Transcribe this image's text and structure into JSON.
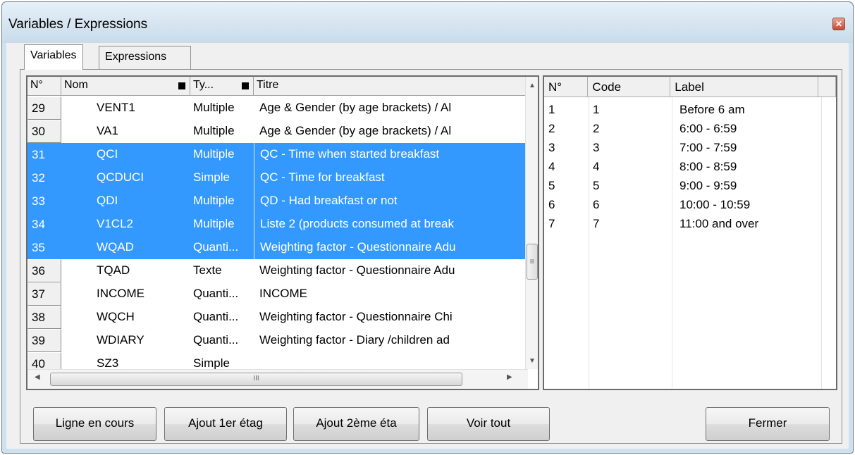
{
  "window": {
    "title": "Variables / Expressions",
    "close_glyph": "✕"
  },
  "tabs": [
    {
      "label": "Variables",
      "active": true
    },
    {
      "label": "Expressions",
      "active": false
    }
  ],
  "variables_grid": {
    "headers": {
      "no": "N°",
      "nom": "Nom",
      "type": "Ty...",
      "titre": "Titre"
    },
    "rows": [
      {
        "no": "29",
        "nom": "VENT1",
        "type": "Multiple",
        "titre": "Age & Gender (by age brackets) / Al",
        "selected": false
      },
      {
        "no": "30",
        "nom": "VA1",
        "type": "Multiple",
        "titre": "Age & Gender (by age brackets) / Al",
        "selected": false
      },
      {
        "no": "31",
        "nom": "QCI",
        "type": "Multiple",
        "titre": "QC - Time when started breakfast",
        "selected": true
      },
      {
        "no": "32",
        "nom": "QCDUCI",
        "type": "Simple",
        "titre": "QC - Time for breakfast",
        "selected": true
      },
      {
        "no": "33",
        "nom": "QDI",
        "type": "Multiple",
        "titre": "QD - Had breakfast or not",
        "selected": true
      },
      {
        "no": "34",
        "nom": "V1CL2",
        "type": "Multiple",
        "titre": "Liste 2 (products consumed at break",
        "selected": true
      },
      {
        "no": "35",
        "nom": "WQAD",
        "type": "Quanti...",
        "titre": "Weighting factor - Questionnaire Adu",
        "selected": true
      },
      {
        "no": "36",
        "nom": "TQAD",
        "type": "Texte",
        "titre": "Weighting factor - Questionnaire Adu",
        "selected": false
      },
      {
        "no": "37",
        "nom": "INCOME",
        "type": "Quanti...",
        "titre": "INCOME",
        "selected": false
      },
      {
        "no": "38",
        "nom": "WQCH",
        "type": "Quanti...",
        "titre": "Weighting factor - Questionnaire Chi",
        "selected": false
      },
      {
        "no": "39",
        "nom": "WDIARY",
        "type": "Quanti...",
        "titre": "Weighting factor - Diary /children  ad",
        "selected": false
      },
      {
        "no": "40",
        "nom": "SZ3",
        "type": "Simple",
        "titre": "",
        "selected": false
      }
    ],
    "scroll_icons": {
      "up": "▲",
      "down": "▼",
      "left": "◀",
      "right": "▶",
      "thumb_grip_v": "≡",
      "thumb_grip_h": "III"
    }
  },
  "codes_grid": {
    "headers": {
      "no": "N°",
      "code": "Code",
      "label": "Label"
    },
    "rows": [
      {
        "no": "1",
        "code": "1",
        "label": "Before 6 am"
      },
      {
        "no": "2",
        "code": "2",
        "label": "6:00 - 6:59"
      },
      {
        "no": "3",
        "code": "3",
        "label": "7:00 - 7:59"
      },
      {
        "no": "4",
        "code": "4",
        "label": "8:00 - 8:59"
      },
      {
        "no": "5",
        "code": "5",
        "label": "9:00 - 9:59"
      },
      {
        "no": "6",
        "code": "6",
        "label": "10:00 - 10:59"
      },
      {
        "no": "7",
        "code": "7",
        "label": "11:00 and over"
      }
    ]
  },
  "buttons": {
    "ligne": "Ligne en cours",
    "ajout1": "Ajout 1er étag",
    "ajout2": "Ajout 2ème éta",
    "voir": "Voir tout",
    "fermer": "Fermer"
  },
  "colors": {
    "selection": "#3399ff",
    "window_frame": "#cfe0ee"
  }
}
